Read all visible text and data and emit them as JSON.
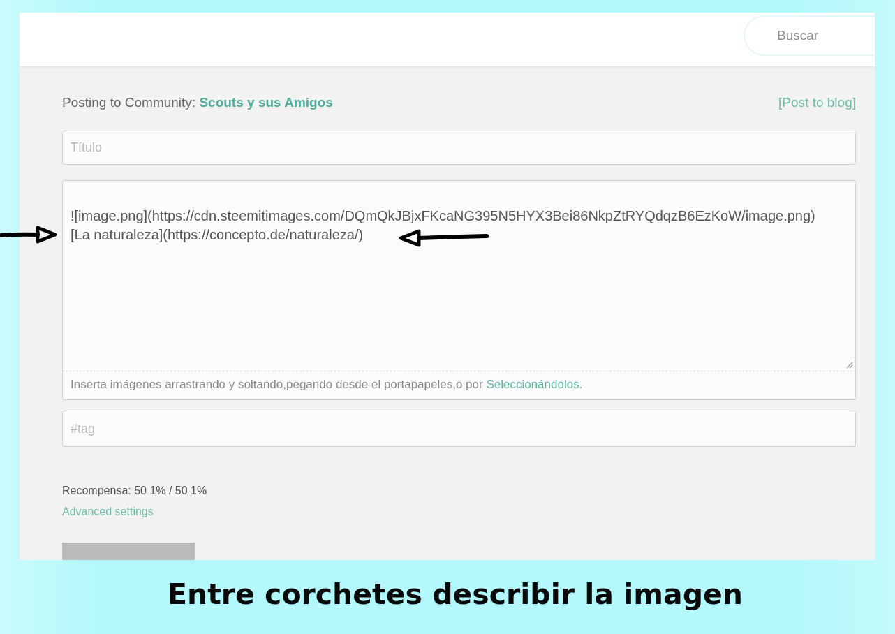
{
  "header": {
    "search": {
      "placeholder": "Buscar"
    }
  },
  "composer": {
    "community": {
      "label": "Posting to Community:",
      "name": "Scouts y sus Amigos"
    },
    "post_to_blog": "[Post to blog]",
    "title": {
      "placeholder": "Título"
    },
    "body": {
      "lines": [
        "![image.png](https://cdn.steemitimages.com/DQmQkJBjxFKcaNG395N5HYX3Bei86NkpZtRYQdqzB6EzKoW/image.png)",
        "[La naturaleza](https://concepto.de/naturaleza/)"
      ],
      "hint": {
        "text": "Inserta imágenes arrastrando y soltando,pegando desde el portapapeles,o por",
        "link": "Seleccionándolos",
        "end": "."
      }
    },
    "tags": {
      "placeholder": "#tag"
    },
    "reward": "Recompensa: 50 1% / 50 1%",
    "advanced_settings": "Advanced settings"
  },
  "caption": "Entre corchetes describir la imagen"
}
